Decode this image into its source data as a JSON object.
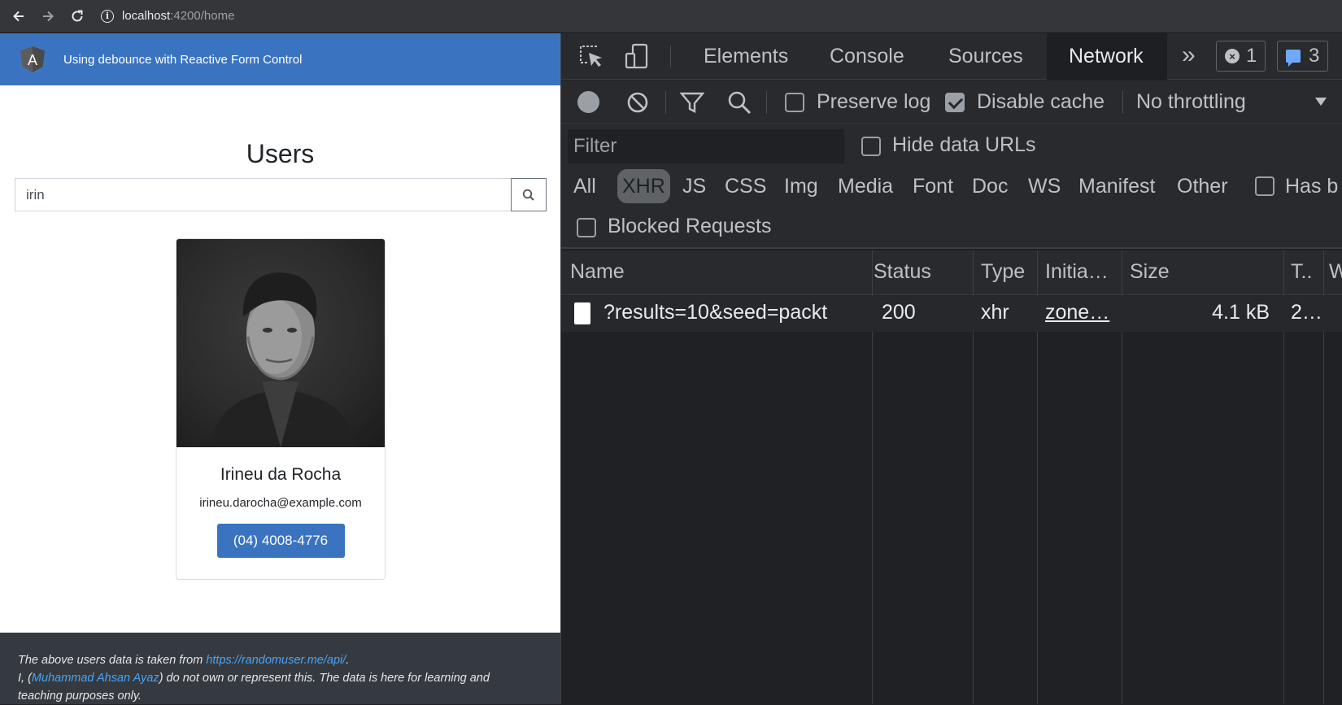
{
  "browser": {
    "url_host": "localhost",
    "url_path": ":4200/home"
  },
  "app": {
    "header_title": "Using debounce with Reactive Form Control",
    "logo_letter": "A",
    "heading": "Users",
    "search": {
      "value": "irin"
    },
    "card": {
      "name": "Irineu da Rocha",
      "email": "irineu.darocha@example.com",
      "phone": "(04) 4008-4776"
    },
    "footer": {
      "line1_prefix": "The above users data is taken from ",
      "line1_link": "https://randomuser.me/api/",
      "line1_suffix": ".",
      "line2_prefix": "I, (",
      "line2_link": "Muhammad Ahsan Ayaz",
      "line2_suffix": ") do not own or represent this. The data is here for learning and",
      "line3": "teaching purposes only."
    }
  },
  "devtools": {
    "tabs": [
      "Elements",
      "Console",
      "Sources",
      "Network"
    ],
    "active_tab": "Network",
    "more_tabs": "»",
    "error_count": "1",
    "message_count": "3",
    "toolbar": {
      "preserve_log": "Preserve log",
      "preserve_log_checked": false,
      "disable_cache": "Disable cache",
      "disable_cache_checked": true,
      "throttling": "No throttling"
    },
    "filter": {
      "placeholder": "Filter",
      "hide_data_urls": "Hide data URLs",
      "types": [
        "All",
        "XHR",
        "JS",
        "CSS",
        "Img",
        "Media",
        "Font",
        "Doc",
        "WS",
        "Manifest",
        "Other"
      ],
      "active_type": "XHR",
      "has_blocked": "Has b",
      "blocked_requests": "Blocked Requests"
    },
    "table": {
      "headers": [
        "Name",
        "Status",
        "Type",
        "Initia…",
        "Size",
        "T..",
        "W"
      ],
      "rows": [
        {
          "name": "?results=10&seed=packt",
          "status": "200",
          "type": "xhr",
          "initiator": "zone…",
          "size": "4.1 kB",
          "time": "2…"
        }
      ]
    }
  }
}
